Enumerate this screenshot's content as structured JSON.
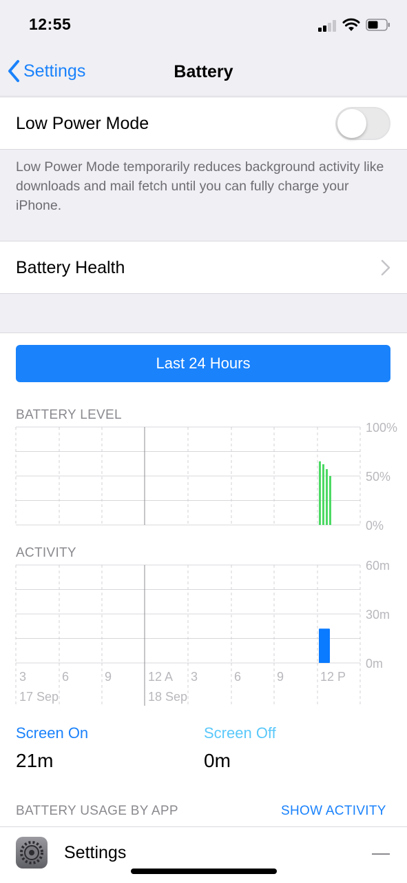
{
  "status_bar": {
    "time": "12:55",
    "icons": [
      "cellular-signal-icon",
      "wifi-icon",
      "battery-icon"
    ]
  },
  "nav": {
    "back_label": "Settings",
    "title": "Battery"
  },
  "low_power": {
    "label": "Low Power Mode",
    "enabled": false,
    "footer": "Low Power Mode temporarily reduces background activity like downloads and mail fetch until you can fully charge your iPhone."
  },
  "battery_health": {
    "label": "Battery Health"
  },
  "usage": {
    "range_button": "Last 24 Hours",
    "battery_level_label": "BATTERY LEVEL",
    "activity_label": "ACTIVITY",
    "screen_on_label": "Screen On",
    "screen_on_value": "21m",
    "screen_off_label": "Screen Off",
    "screen_off_value": "0m",
    "by_app_label": "BATTERY USAGE BY APP",
    "show_activity": "SHOW ACTIVITY",
    "apps": [
      {
        "name": "Settings",
        "icon": "settings-gear-icon",
        "value": "—"
      }
    ]
  },
  "colors": {
    "accent": "#1a82fb",
    "battery_bar": "#4cd964",
    "activity_bar": "#0a7aff",
    "screen_off": "#5ac8fa"
  },
  "chart_data": [
    {
      "type": "bar",
      "title": "BATTERY LEVEL",
      "y_ticks": [
        "100%",
        "50%",
        "0%"
      ],
      "ylim": [
        0,
        100
      ],
      "x_ticks": [
        "3",
        "6",
        "9",
        "12 A",
        "3",
        "6",
        "9",
        "12 P"
      ],
      "date_labels": [
        "17 Sep",
        "18 Sep"
      ],
      "series": [
        {
          "x": [
            "12:00",
            "12:15",
            "12:30",
            "12:45"
          ],
          "values": [
            65,
            62,
            57,
            50
          ]
        }
      ]
    },
    {
      "type": "bar",
      "title": "ACTIVITY",
      "y_ticks": [
        "60m",
        "30m",
        "0m"
      ],
      "ylim": [
        0,
        60
      ],
      "x_ticks": [
        "3",
        "6",
        "9",
        "12 A",
        "3",
        "6",
        "9",
        "12 P"
      ],
      "date_labels": [
        "17 Sep",
        "18 Sep"
      ],
      "series": [
        {
          "x": [
            "12 P"
          ],
          "values": [
            21
          ]
        }
      ]
    }
  ]
}
